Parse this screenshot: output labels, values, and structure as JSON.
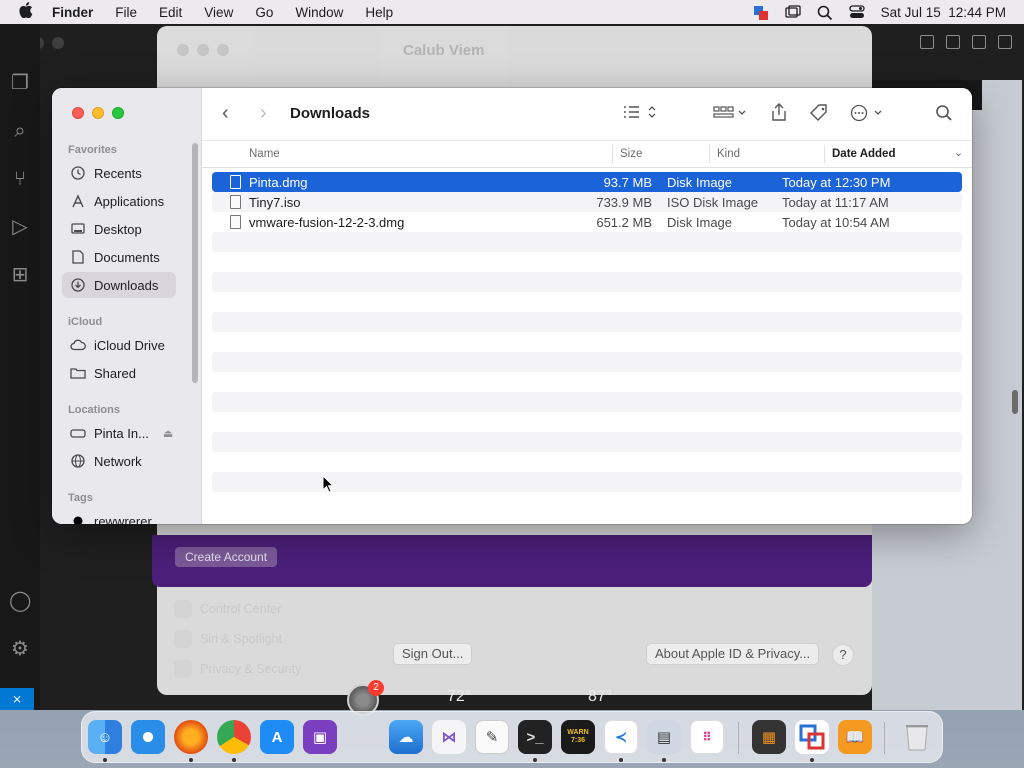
{
  "menubar": {
    "app": "Finder",
    "items": [
      "File",
      "Edit",
      "View",
      "Go",
      "Window",
      "Help"
    ],
    "clock": "Sat Jul 15  12:44 PM"
  },
  "background": {
    "settings_title": "Calub Viem",
    "create_account": "Create Account",
    "faded_items": [
      "Control Center",
      "Siri & Spotlight",
      "Privacy & Security"
    ],
    "sign_out": "Sign Out...",
    "about_privacy": "About Apple ID & Privacy...",
    "help": "?",
    "weather": "72°",
    "weather2": "87°",
    "dock_badge": "2"
  },
  "finder": {
    "title": "Downloads",
    "sidebar": {
      "favorites_header": "Favorites",
      "favorites": [
        {
          "label": "Recents",
          "icon": "clock-icon"
        },
        {
          "label": "Applications",
          "icon": "applications-icon"
        },
        {
          "label": "Desktop",
          "icon": "desktop-icon"
        },
        {
          "label": "Documents",
          "icon": "document-icon"
        },
        {
          "label": "Downloads",
          "icon": "download-icon"
        }
      ],
      "icloud_header": "iCloud",
      "icloud": [
        {
          "label": "iCloud Drive",
          "icon": "cloud-icon"
        },
        {
          "label": "Shared",
          "icon": "shared-folder-icon"
        }
      ],
      "locations_header": "Locations",
      "locations": [
        {
          "label": "Pinta In...",
          "icon": "disk-icon"
        },
        {
          "label": "Network",
          "icon": "globe-icon"
        }
      ],
      "tags_header": "Tags",
      "tags": [
        {
          "label": "rewwrerer",
          "color": "#000000"
        }
      ]
    },
    "columns": {
      "name": "Name",
      "size": "Size",
      "kind": "Kind",
      "date": "Date Added"
    },
    "files": [
      {
        "name": "Pinta.dmg",
        "size": "93.7 MB",
        "kind": "Disk Image",
        "date": "Today at 12:30 PM",
        "selected": true
      },
      {
        "name": "Tiny7.iso",
        "size": "733.9 MB",
        "kind": "ISO Disk Image",
        "date": "Today at 11:17 AM",
        "selected": false
      },
      {
        "name": "vmware-fusion-12-2-3.dmg",
        "size": "651.2 MB",
        "kind": "Disk Image",
        "date": "Today at 10:54 AM",
        "selected": false
      }
    ]
  },
  "colors": {
    "selection": "#1b63d8",
    "sidebar_bg": "#e9e8ec",
    "close": "#ff5f57",
    "minimize": "#febc2e",
    "maximize": "#28c840"
  }
}
